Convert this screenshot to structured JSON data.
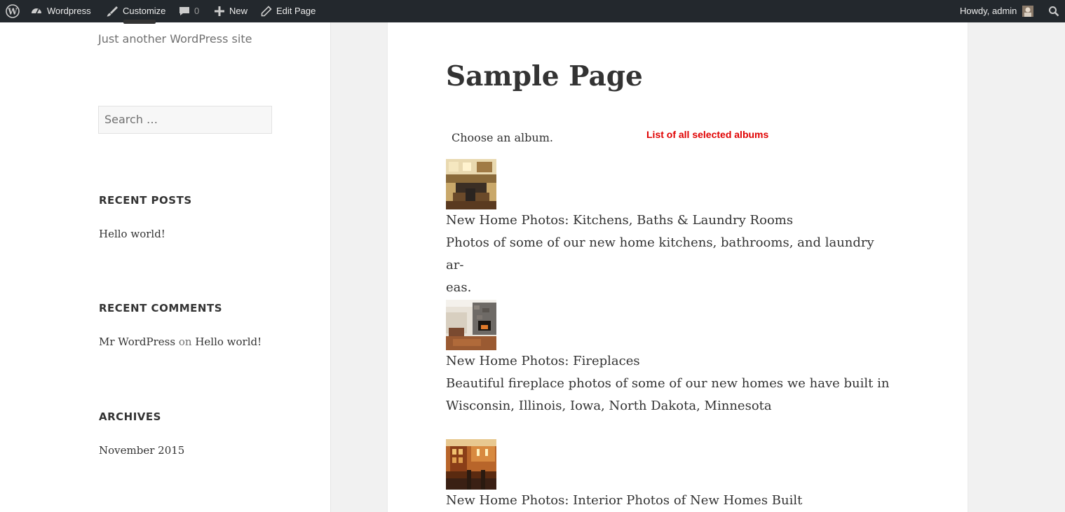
{
  "admin_bar": {
    "site_name": "Wordpress",
    "customize": "Customize",
    "comments_count": "0",
    "new": "New",
    "edit_page": "Edit Page",
    "greeting": "Howdy, admin"
  },
  "sidebar": {
    "tagline": "Just another WordPress site",
    "search_placeholder": "Search …",
    "recent_posts": {
      "title": "RECENT POSTS",
      "items": [
        "Hello world!"
      ]
    },
    "recent_comments": {
      "title": "RECENT COMMENTS",
      "author": "Mr WordPress",
      "on": "on",
      "post": "Hello world!"
    },
    "archives": {
      "title": "ARCHIVES",
      "items": [
        "November 2015"
      ]
    }
  },
  "main": {
    "page_title": "Sample Page",
    "choose_label": "Choose an album.",
    "annotation": "List of all selected albums",
    "albums": [
      {
        "title": "New Home Photos: Kitchens, Baths & Laundry Rooms",
        "desc_line1": "Photos of some of our new home kitchens, bathrooms, and laundry ar-",
        "desc_line2": "eas.",
        "thumb_icon": "kitchen-thumbnail"
      },
      {
        "title": "New Home Photos: Fireplaces",
        "desc_line1": "Beautiful fireplace photos of some of our new homes we have built in",
        "desc_line2": "Wisconsin, Illinois, Iowa, North Dakota, Minnesota",
        "thumb_icon": "fireplace-thumbnail"
      },
      {
        "title": "New Home Photos: Interior Photos of New Homes Built",
        "thumb_icon": "interior-thumbnail"
      }
    ]
  },
  "colors": {
    "admin_bar_bg": "#23282d",
    "annotation": "#e00000",
    "page_bg": "#f1f1f1"
  }
}
